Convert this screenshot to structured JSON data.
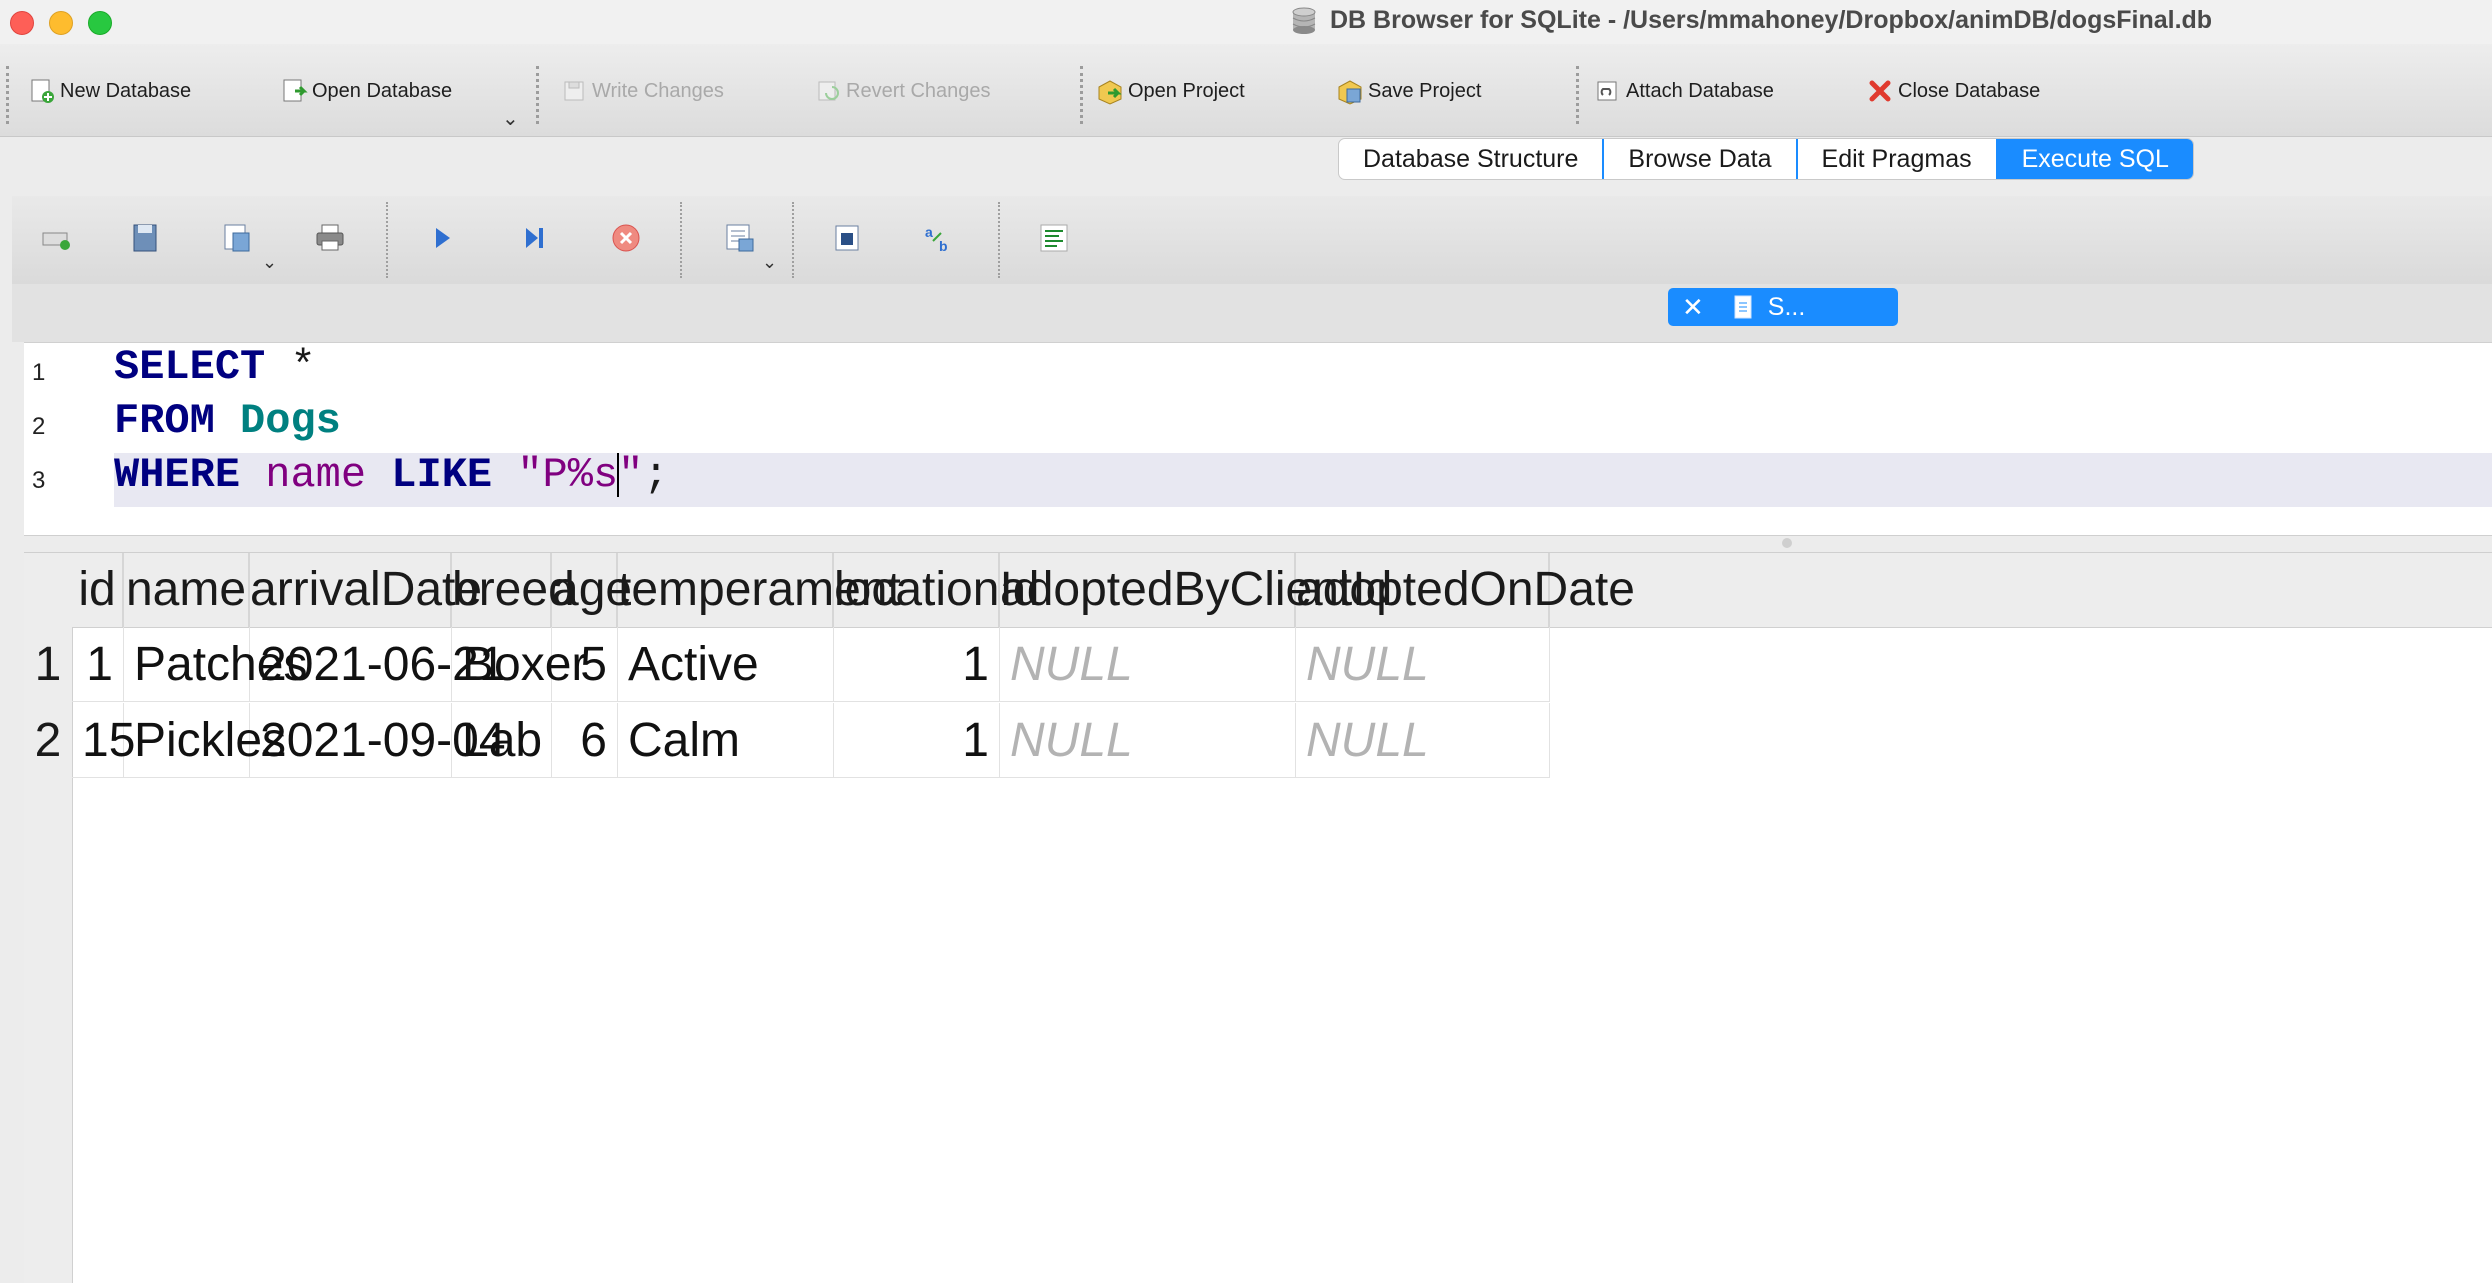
{
  "window": {
    "title": "DB Browser for SQLite - /Users/mmahoney/Dropbox/animDB/dogsFinal.db"
  },
  "toolbar": {
    "new_database": "New Database",
    "open_database": "Open Database",
    "write_changes": "Write Changes",
    "revert_changes": "Revert Changes",
    "open_project": "Open Project",
    "save_project": "Save Project",
    "attach_database": "Attach Database",
    "close_database": "Close Database"
  },
  "tabs": [
    "Database Structure",
    "Browse Data",
    "Edit Pragmas",
    "Execute SQL"
  ],
  "active_tab": "Execute SQL",
  "editor_tab": {
    "label": "S..."
  },
  "editor": {
    "line_numbers": [
      "1",
      "2",
      "3"
    ],
    "lines": [
      [
        {
          "t": "SELECT",
          "c": "kw"
        },
        {
          "t": " *",
          "c": "plain"
        }
      ],
      [
        {
          "t": "FROM",
          "c": "kw"
        },
        {
          "t": " ",
          "c": "plain"
        },
        {
          "t": "Dogs",
          "c": "tbl"
        }
      ],
      [
        {
          "t": "WHERE",
          "c": "kw"
        },
        {
          "t": " ",
          "c": "plain"
        },
        {
          "t": "name",
          "c": "col"
        },
        {
          "t": " ",
          "c": "plain"
        },
        {
          "t": "LIKE",
          "c": "kw"
        },
        {
          "t": " ",
          "c": "plain"
        },
        {
          "t": "\"P%s",
          "c": "str"
        },
        {
          "t": "|",
          "c": "caret"
        },
        {
          "t": "\"",
          "c": "str"
        },
        {
          "t": ";",
          "c": "plain"
        }
      ]
    ]
  },
  "results": {
    "columns": [
      "id",
      "name",
      "arrivalDate",
      "breed",
      "age",
      "temperament",
      "locationId",
      "adoptedByClientId",
      "adoptedOnDate"
    ],
    "row_headers": [
      "1",
      "2"
    ],
    "rows": [
      [
        "1",
        "Patches",
        "2021-06-21",
        "Boxer",
        "5",
        "Active",
        "1",
        "NULL",
        "NULL"
      ],
      [
        "15",
        "Pickles",
        "2021-09-04",
        "Lab",
        "6",
        "Calm",
        "1",
        "NULL",
        "NULL"
      ]
    ]
  },
  "colors": {
    "accent": "#1a8cff",
    "keyword": "#000080",
    "table": "#008080",
    "string": "#800080",
    "null": "#b3b3b3"
  }
}
